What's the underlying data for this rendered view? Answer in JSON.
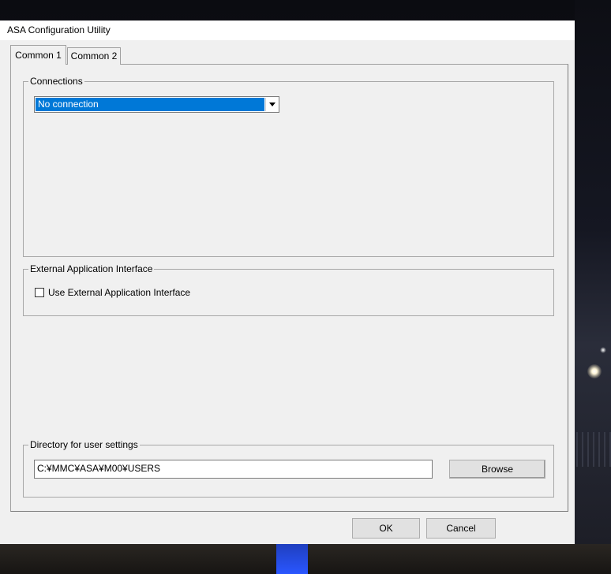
{
  "window": {
    "title": "ASA Configuration Utility"
  },
  "tabs": [
    {
      "label": "Common 1",
      "active": true
    },
    {
      "label": "Common 2",
      "active": false
    }
  ],
  "connections": {
    "group_label": "Connections",
    "selected_value": "No connection"
  },
  "external_interface": {
    "group_label": "External Application Interface",
    "checkbox_label": "Use External Application Interface",
    "checked": false
  },
  "user_settings": {
    "group_label": "Directory for user settings",
    "path_value": "C:¥MMC¥ASA¥M00¥USERS",
    "browse_label": "Browse"
  },
  "footer": {
    "ok_label": "OK",
    "cancel_label": "Cancel"
  },
  "colors": {
    "window_bg": "#f0f0f0",
    "selection": "#0078d7",
    "button_bg": "#e1e1e1"
  },
  "icons": {
    "dropdown": "chevron-down-icon"
  }
}
